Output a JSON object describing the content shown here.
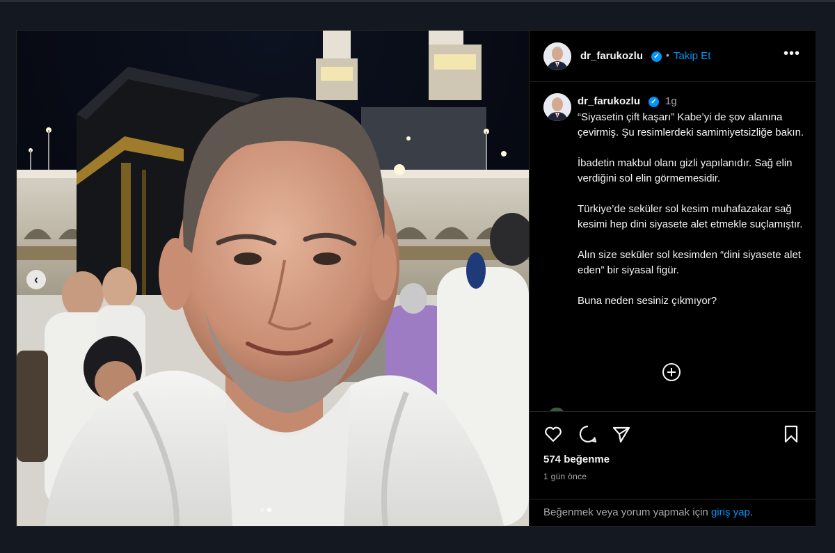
{
  "post": {
    "username": "dr_farukozlu",
    "follow_label": "Takip Et",
    "separator": "•",
    "verified_mark": "✓",
    "time_ago_short": "1g",
    "caption_paragraphs": [
      "“Siyasetin çift kaşarı” Kabe’yi de şov alanına çevirmiş. Şu resimlerdeki samimiyetsizliğe bakın.",
      "İbadetin makbul olanı gizli yapılanıdır. Sağ elin verdiğini sol elin görmemesidir.",
      "Türkiye’de seküler sol kesim muhafazakar sağ kesimi hep dini siyasete alet etmekle suçlamıştır.",
      "Alın size seküler sol kesimden “dini siyasete alet eden” bir siyasal figür.",
      "Buna neden sesiniz çıkmıyor?"
    ],
    "likes": "574 beğenme",
    "time_ago": "1 gün önce",
    "login_prompt": "Beğenmek veya yorum yapmak için",
    "login_link": "giriş yap",
    "login_suffix": "."
  },
  "icons": {
    "prev": "‹",
    "more": "•••",
    "names": [
      "heart-icon",
      "comment-icon",
      "share-icon",
      "bookmark-icon",
      "plus-circle-icon"
    ]
  },
  "carousel": {
    "count": 2,
    "active": 1
  },
  "colors": {
    "background": "#131821",
    "post_bg": "#000000",
    "accent": "#0095f6",
    "text": "#f5f5f5",
    "muted": "#a8a8a8"
  }
}
